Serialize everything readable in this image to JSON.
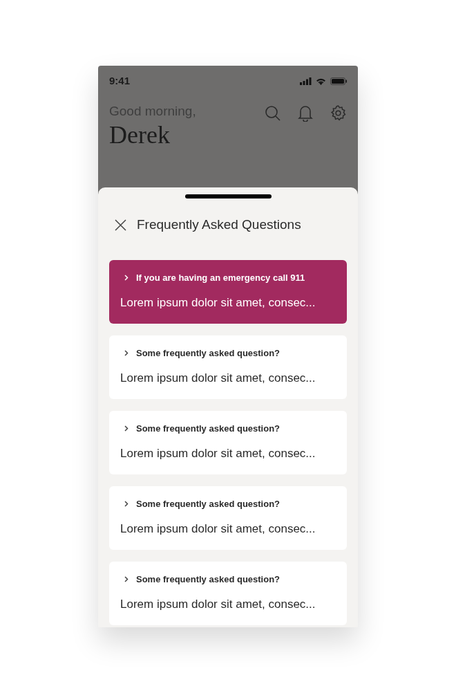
{
  "status_bar": {
    "time": "9:41"
  },
  "header": {
    "greeting": "Good morning,",
    "name": "Derek"
  },
  "sheet": {
    "title": "Frequently Asked Questions",
    "items": [
      {
        "kind": "emergency",
        "question": "If you are having an emergency call 911",
        "answer": "Lorem ipsum dolor sit amet, consec..."
      },
      {
        "kind": "faq",
        "question": "Some frequently asked question?",
        "answer": "Lorem ipsum dolor sit amet, consec..."
      },
      {
        "kind": "faq",
        "question": "Some frequently asked question?",
        "answer": "Lorem ipsum dolor sit amet, consec..."
      },
      {
        "kind": "faq",
        "question": "Some frequently asked question?",
        "answer": "Lorem ipsum dolor sit amet, consec..."
      },
      {
        "kind": "faq",
        "question": "Some frequently asked question?",
        "answer": "Lorem ipsum dolor sit amet, consec..."
      }
    ]
  }
}
